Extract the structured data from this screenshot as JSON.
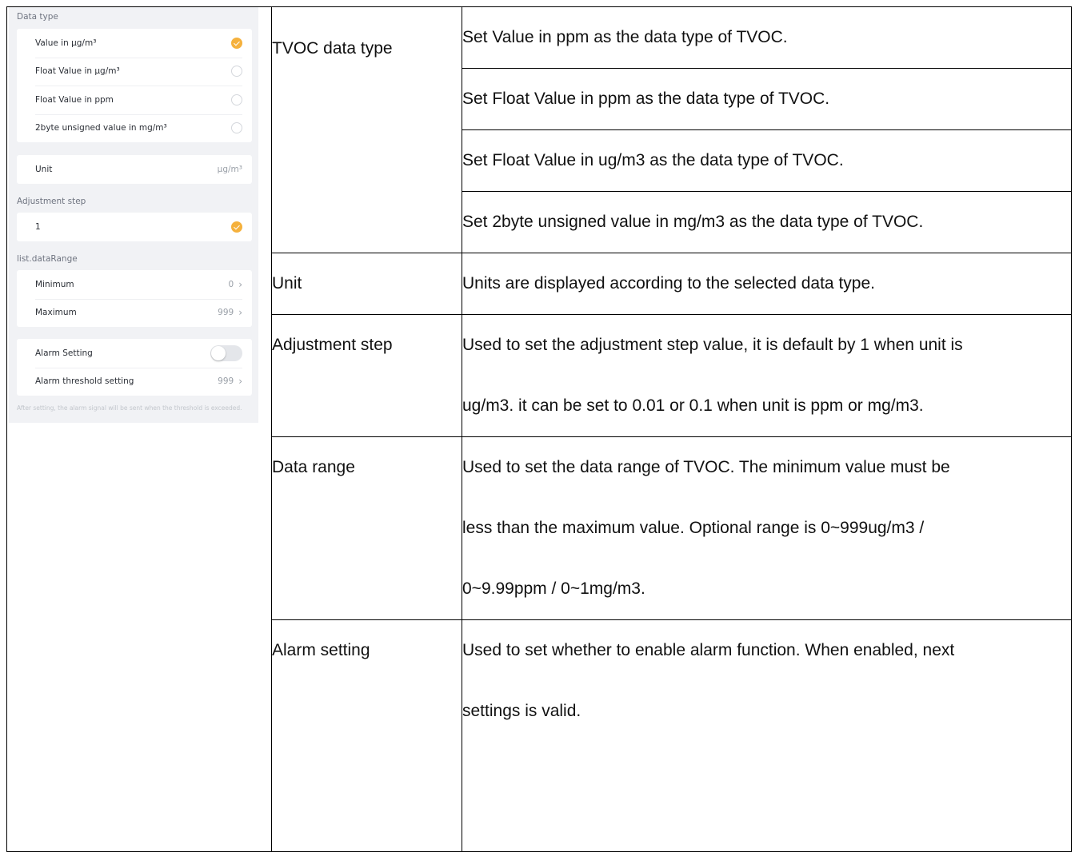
{
  "screenshot": {
    "data_type_title": "Data type",
    "data_type_options": [
      {
        "label": "Value in μg/m³",
        "selected": true
      },
      {
        "label": "Float Value in μg/m³",
        "selected": false
      },
      {
        "label": "Float Value in ppm",
        "selected": false
      },
      {
        "label": "2byte unsigned value in mg/m³",
        "selected": false
      }
    ],
    "unit_label": "Unit",
    "unit_value": "μg/m³",
    "adjustment_title": "Adjustment step",
    "adjustment_value": "1",
    "range_title": "list.dataRange",
    "minimum_label": "Minimum",
    "minimum_value": "0",
    "maximum_label": "Maximum",
    "maximum_value": "999",
    "alarm_label": "Alarm Setting",
    "alarm_enabled": false,
    "threshold_label": "Alarm threshold setting",
    "threshold_value": "999",
    "hint": "After setting, the alarm signal will be sent when the threshold is exceeded."
  },
  "table": {
    "tvoc_param": "TVOC data type",
    "tvoc_desc": [
      "Set Value in ppm as the data type of TVOC.",
      "Set Float Value in ppm as the data type of TVOC.",
      "Set Float Value in ug/m3 as the data type of TVOC.",
      "Set 2byte unsigned value in mg/m3 as the data type of TVOC."
    ],
    "unit_param": "Unit",
    "unit_desc": "Units are displayed according to the selected data type.",
    "step_param": "Adjustment step",
    "step_desc": [
      "Used to set the adjustment step value, it is default by 1 when unit is",
      "ug/m3. it can be set to 0.01 or 0.1 when unit is ppm or mg/m3."
    ],
    "range_param": "Data range",
    "range_desc": [
      "Used to set the data range of TVOC. The minimum value must be",
      "less than the maximum value. Optional range is 0~999ug/m3 /",
      "0~9.99ppm / 0~1mg/m3."
    ],
    "alarm_param": "Alarm setting",
    "alarm_desc": [
      "Used to set whether to enable alarm function. When enabled, next",
      "settings is valid."
    ]
  }
}
